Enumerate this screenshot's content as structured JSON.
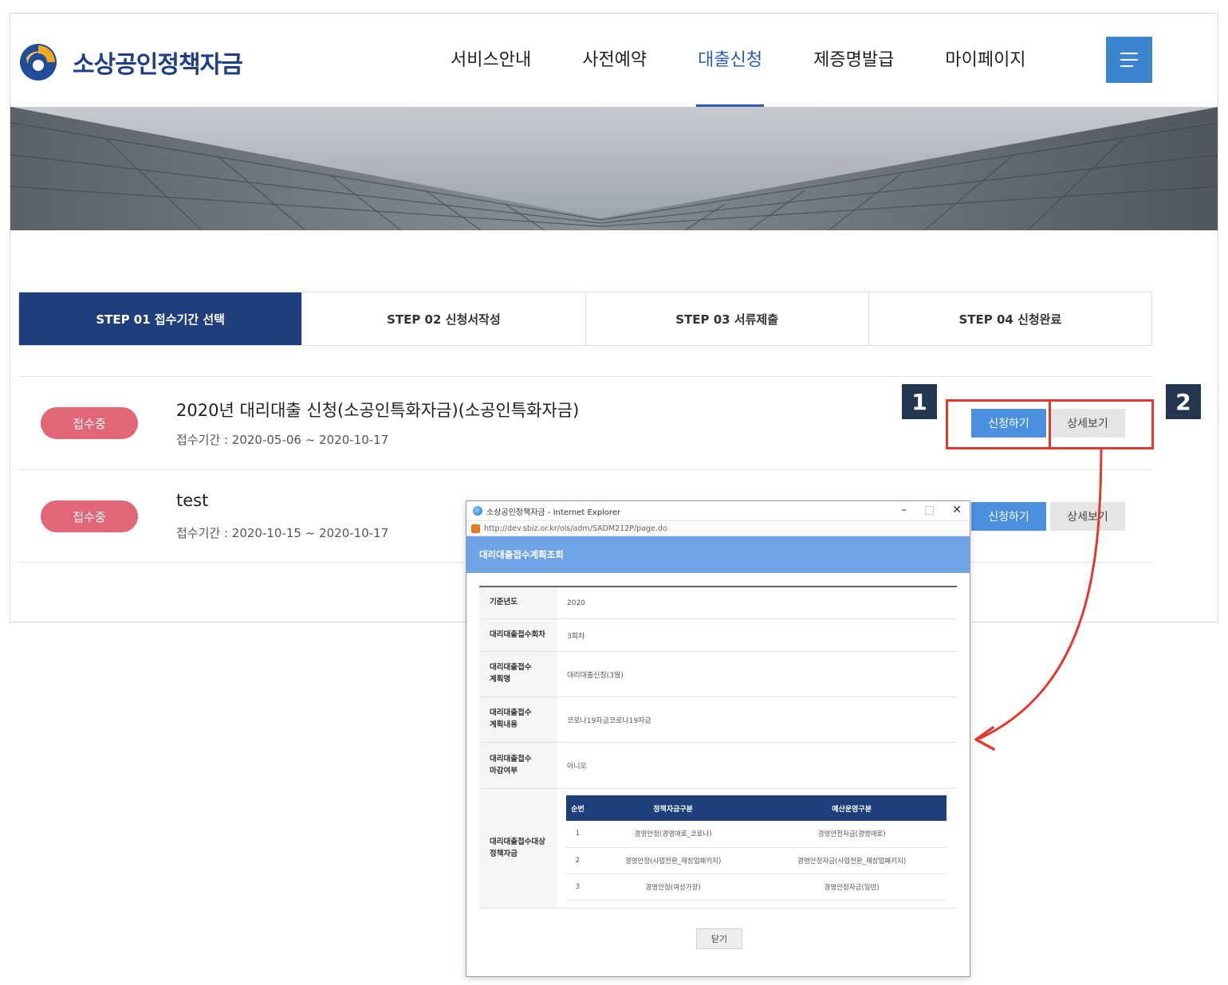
{
  "site": {
    "logo_text": "소상공인정책자금",
    "colors": {
      "brand": "#1f3f86",
      "accent": "#2a5db8",
      "badge": "#e16677",
      "highlight": "#e03a2e"
    }
  },
  "nav": {
    "items": [
      {
        "label": "서비스안내"
      },
      {
        "label": "사전예약"
      },
      {
        "label": "대출신청",
        "active": true
      },
      {
        "label": "제증명발급"
      },
      {
        "label": "마이페이지"
      }
    ],
    "menu_icon": "hamburger-icon"
  },
  "steps": [
    {
      "label": "STEP 01 접수기간 선택",
      "active": true
    },
    {
      "label": "STEP 02 신청서작성"
    },
    {
      "label": "STEP 03 서류제출"
    },
    {
      "label": "STEP 04 신청완료"
    }
  ],
  "applications": [
    {
      "status": "접수중",
      "title": "2020년 대리대출 신청(소공인특화자금)(소공인특화자금)",
      "period": "접수기간 : 2020-05-06 ~ 2020-10-17",
      "apply_label": "신청하기",
      "detail_label": "상세보기"
    },
    {
      "status": "접수중",
      "title": "test",
      "period": "접수기간 : 2020-10-15 ~ 2020-10-17",
      "apply_label": "신청하기",
      "detail_label": "상세보기"
    }
  ],
  "markers": {
    "one": "1",
    "two": "2"
  },
  "popup": {
    "window_title": "소상공인정책자금 - Internet Explorer",
    "url": "http://dev.sbiz.or.kr/ols/adm/SADM212P/page.do",
    "heading": "대리대출접수계획조회",
    "fields": [
      {
        "label": "기준년도",
        "value": "2020"
      },
      {
        "label": "대리대출접수회차",
        "value": "3회차"
      },
      {
        "label": "대리대출접수\n계획명",
        "value": "대리대출신청(3월)"
      },
      {
        "label": "대리대출접수\n계획내용",
        "value": "코로나19자금코로나19자금"
      },
      {
        "label": "대리대출접수\n마감여부",
        "value": "아니오"
      }
    ],
    "target_label": "대리대출접수대상\n정책자금",
    "target_table": {
      "headers": [
        "순번",
        "정책자금구분",
        "예산운영구분"
      ],
      "rows": [
        [
          "1",
          "경영안정(경영애로_코로나)",
          "경영안전자금(경영애로)"
        ],
        [
          "2",
          "경영안정(사업전환_재창업패키지)",
          "경영안정자금(사업전환_재창업패키지)"
        ],
        [
          "3",
          "경영안정(여성가장)",
          "경영안정자금(일반)"
        ]
      ]
    },
    "close_label": "닫기"
  }
}
